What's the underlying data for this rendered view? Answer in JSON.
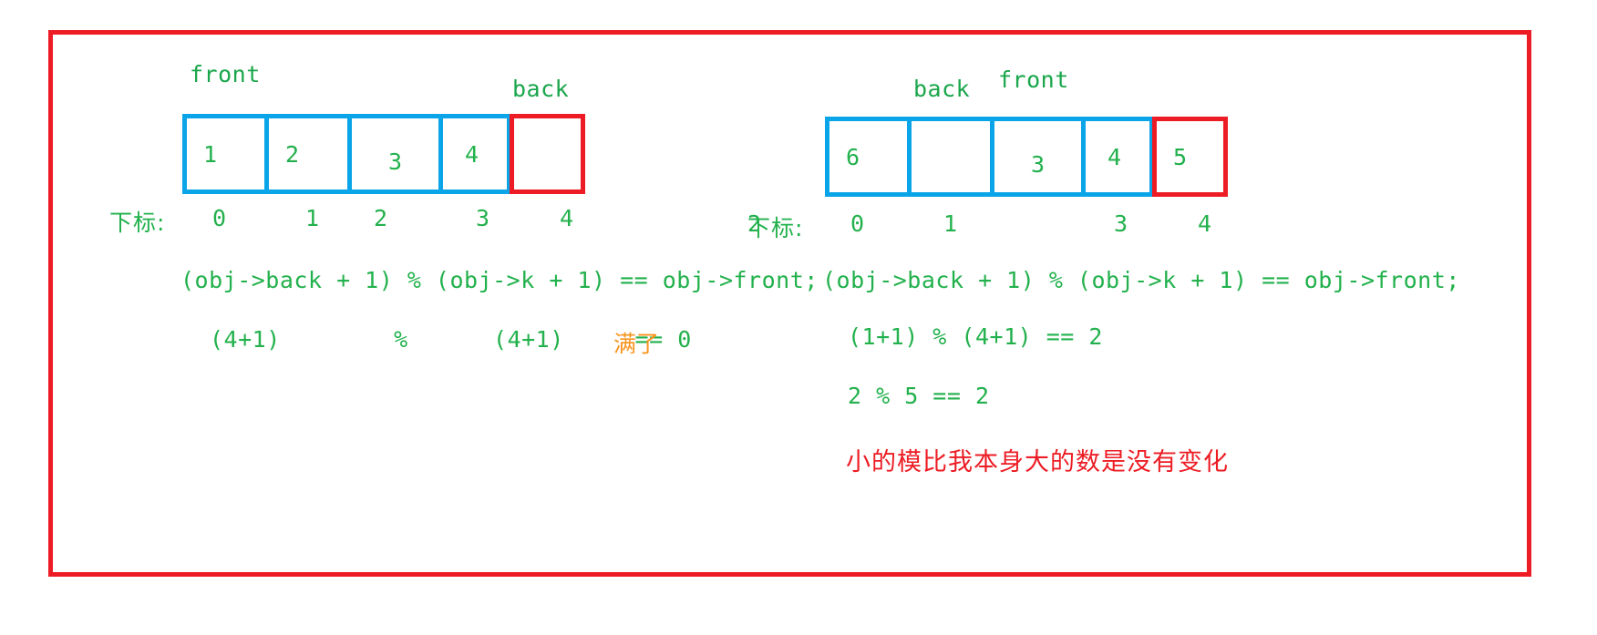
{
  "frame": {
    "border_color": "#ed1c24"
  },
  "colors": {
    "array_blue": "#0aa5e8",
    "array_red": "#ed1c24",
    "text_green": "#22b14c",
    "note_orange": "#f7941d",
    "note_red": "#ed1c24"
  },
  "left": {
    "front_label": "front",
    "back_label": "back",
    "cells": [
      {
        "value": "1",
        "style": "blue"
      },
      {
        "value": "2",
        "style": "blue"
      },
      {
        "value": "3",
        "style": "blue"
      },
      {
        "value": "4",
        "style": "blue"
      },
      {
        "value": "",
        "style": "red"
      }
    ],
    "index_label": "下标:",
    "indices": [
      "0",
      "1",
      "2",
      "3",
      "4"
    ],
    "formula": "(obj->back + 1) % (obj->k + 1) == obj->front;",
    "evaluation": "(4+1)        %      (4+1)     == 0",
    "note": "满了"
  },
  "right": {
    "back_label": "back",
    "front_label": "front",
    "cells": [
      {
        "value": "6",
        "style": "blue"
      },
      {
        "value": "",
        "style": "blue"
      },
      {
        "value": "3",
        "style": "blue"
      },
      {
        "value": "4",
        "style": "blue"
      },
      {
        "value": "5",
        "style": "red"
      }
    ],
    "index_label": "下标:",
    "indices": [
      "0",
      "1",
      "2",
      "3",
      "4"
    ],
    "formula": "(obj->back + 1) % (obj->k + 1) == obj->front;",
    "evaluation_1": "(1+1) % (4+1) == 2",
    "evaluation_2": "2 % 5 == 2",
    "note": "小的模比我本身大的数是没有变化"
  }
}
